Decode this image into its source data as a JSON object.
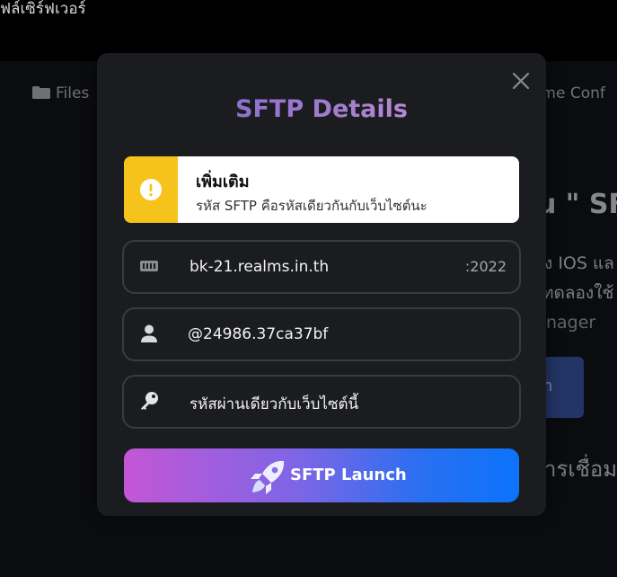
{
  "background": {
    "page_title": "ฟล์เซิร์ฟเวอร์",
    "tab_files": "Files",
    "tab_game_config": "ame Conf",
    "heading": "u \" SF",
    "line1": "ัง IOS แล",
    "line2": "ทดลองใช้",
    "line3": "nager",
    "button_label": "n",
    "line4": "ารเชื่อม"
  },
  "modal": {
    "title": "SFTP Details",
    "notice": {
      "title": "เพิ่มเติม",
      "text": "รหัส SFTP คือรหัสเดียวกันกับเว็บไซต์นะ",
      "icon": "exclamation-icon",
      "accent_color": "#f5c31b"
    },
    "host": {
      "value": "bk-21.realms.in.th",
      "port": ":2022",
      "icon": "server-icon"
    },
    "username": {
      "value": "@24986.37ca37bf",
      "icon": "user-icon"
    },
    "password": {
      "value": "รหัสผ่านเดียวกับเว็บไซต์นี้",
      "icon": "key-icon"
    },
    "launch_button": {
      "label": "SFTP Launch",
      "icon": "rocket-icon"
    },
    "close_icon": "close-icon"
  }
}
